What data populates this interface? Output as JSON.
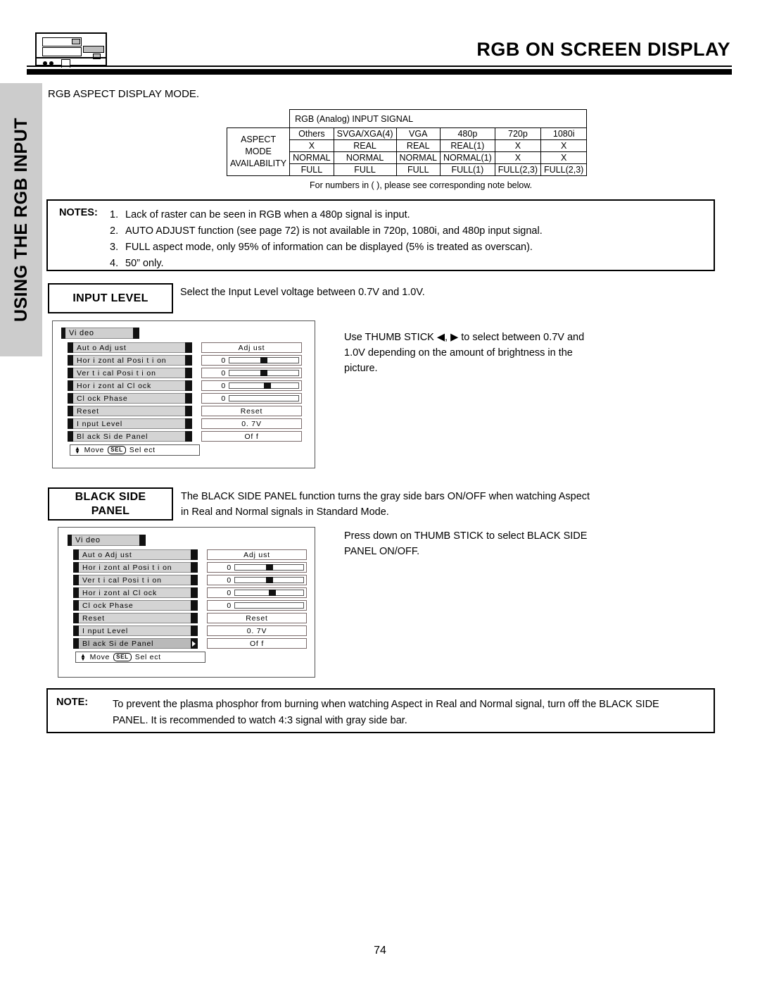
{
  "header": {
    "title": "RGB ON SCREEN DISPLAY",
    "device_icon": "vcr-device-icon"
  },
  "side_tab": {
    "label": "USING THE RGB INPUT"
  },
  "section_label": "RGB ASPECT DISPLAY MODE.",
  "signal_table": {
    "title": "RGB (Analog) INPUT SIGNAL",
    "row_label": [
      "ASPECT",
      "MODE",
      "AVAILABILITY"
    ],
    "columns": [
      "Others",
      "SVGA/XGA(4)",
      "VGA",
      "480p",
      "720p",
      "1080i"
    ],
    "rows": [
      [
        "X",
        "REAL",
        "REAL",
        "REAL(1)",
        "X",
        "X"
      ],
      [
        "NORMAL",
        "NORMAL",
        "NORMAL",
        "NORMAL(1)",
        "X",
        "X"
      ],
      [
        "FULL",
        "FULL",
        "FULL",
        "FULL(1)",
        "FULL(2,3)",
        "FULL(2,3)"
      ]
    ],
    "footnote": "For numbers in ( ), please see corresponding note below."
  },
  "notes_box": {
    "heading": "NOTES:",
    "items": [
      {
        "num": "1.",
        "text": "Lack of raster can be seen in RGB when a 480p signal is input."
      },
      {
        "num": "2.",
        "text": "AUTO ADJUST function (see page 72) is not available in 720p, 1080i, and 480p input signal."
      },
      {
        "num": "3.",
        "text": "FULL aspect mode, only 95% of information can be displayed (5% is treated as overscan)."
      },
      {
        "num": "4.",
        "text": "50” only."
      }
    ]
  },
  "input_level": {
    "heading": "INPUT LEVEL",
    "description": "Select the Input Level voltage between 0.7V and 1.0V.",
    "instruction_line1": "Use THUMB STICK ◀, ▶ to select between 0.7V and",
    "instruction_line2": "1.0V depending on the amount of brightness in the",
    "instruction_line3": "picture."
  },
  "black_side_panel": {
    "heading_line1": "BLACK SIDE",
    "heading_line2": "PANEL",
    "description_line1": "The BLACK SIDE PANEL function turns the gray side bars ON/OFF when watching Aspect",
    "description_line2": "in Real and Normal signals in Standard Mode.",
    "instruction_line1": "Press down on THUMB STICK to select BLACK SIDE",
    "instruction_line2": "PANEL ON/OFF."
  },
  "osd_menu_1": {
    "title": "Vi deo",
    "selected_row": "Input  Level",
    "rows": [
      {
        "label": "Aut o  Adj ust",
        "value": "Adj ust",
        "type": "text"
      },
      {
        "label": "Hor i zont al   Posi t i on",
        "value": "0",
        "type": "slider",
        "knob": 50
      },
      {
        "label": "Ver t i cal   Posi t i on",
        "value": "0",
        "type": "slider",
        "knob": 50
      },
      {
        "label": "Hor i zont al   Cl ock",
        "value": "0",
        "type": "slider",
        "knob": 55
      },
      {
        "label": "Cl ock  Phase",
        "value": "0",
        "type": "slider-empty"
      },
      {
        "label": "Reset",
        "value": "Reset",
        "type": "text"
      },
      {
        "label": "I nput   Level",
        "value": "0. 7V",
        "type": "text"
      },
      {
        "label": "Bl ack  Si de  Panel",
        "value": "Of f",
        "type": "text"
      }
    ],
    "footer_move": "Move",
    "footer_sel_chip": "SEL",
    "footer_select": "Sel ect"
  },
  "osd_menu_2": {
    "title": "Vi deo",
    "selected_row": "Bl ack  Si de  Panel",
    "rows": [
      {
        "label": "Aut o  Adj ust",
        "value": "Adj ust",
        "type": "text"
      },
      {
        "label": "Hor i zont al   Posi t i on",
        "value": "0",
        "type": "slider",
        "knob": 50
      },
      {
        "label": "Ver t i cal   Posi t i on",
        "value": "0",
        "type": "slider",
        "knob": 50
      },
      {
        "label": "Hor i zont al   Cl ock",
        "value": "0",
        "type": "slider",
        "knob": 55
      },
      {
        "label": "Cl ock  Phase",
        "value": "0",
        "type": "slider-empty"
      },
      {
        "label": "Reset",
        "value": "Reset",
        "type": "text"
      },
      {
        "label": "I nput   Level",
        "value": "0. 7V",
        "type": "text"
      },
      {
        "label": "Bl ack  Si de  Panel",
        "value": "Of f",
        "type": "text"
      }
    ],
    "footer_move": "Move",
    "footer_sel_chip": "SEL",
    "footer_select": "Sel ect"
  },
  "bottom_note": {
    "heading": "NOTE:",
    "line1": "To prevent the plasma phosphor from burning when watching Aspect in Real and Normal signal, turn off the BLACK SIDE",
    "line2": "PANEL.  It is recommended to watch 4:3 signal with gray side bar."
  },
  "page_number": "74"
}
